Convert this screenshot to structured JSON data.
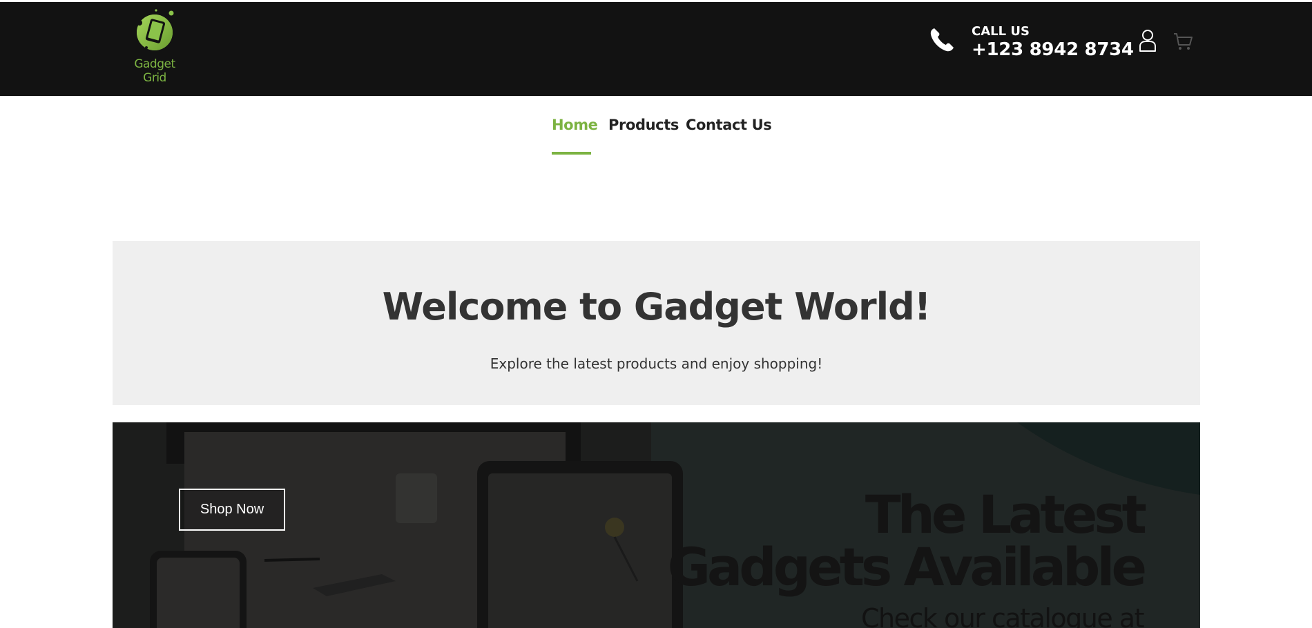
{
  "brand": {
    "name": "Gadget Grid",
    "accent_color": "#7cb342"
  },
  "header": {
    "call_label": "CALL US",
    "phone": "+123 8942 8734",
    "icons": [
      "phone-icon",
      "user-icon",
      "cart-icon"
    ]
  },
  "nav": {
    "items": [
      {
        "label": "Home",
        "active": true
      },
      {
        "label": "Products",
        "active": false
      },
      {
        "label": "Contact Us",
        "active": false
      }
    ]
  },
  "welcome": {
    "title": "Welcome to Gadget World!",
    "subtitle": "Explore the latest products and enjoy shopping!"
  },
  "banner": {
    "button_label": "Shop Now",
    "headline_line1": "The Latest",
    "headline_line2": "Gadgets Available",
    "subline": "Check our catalogue at"
  }
}
